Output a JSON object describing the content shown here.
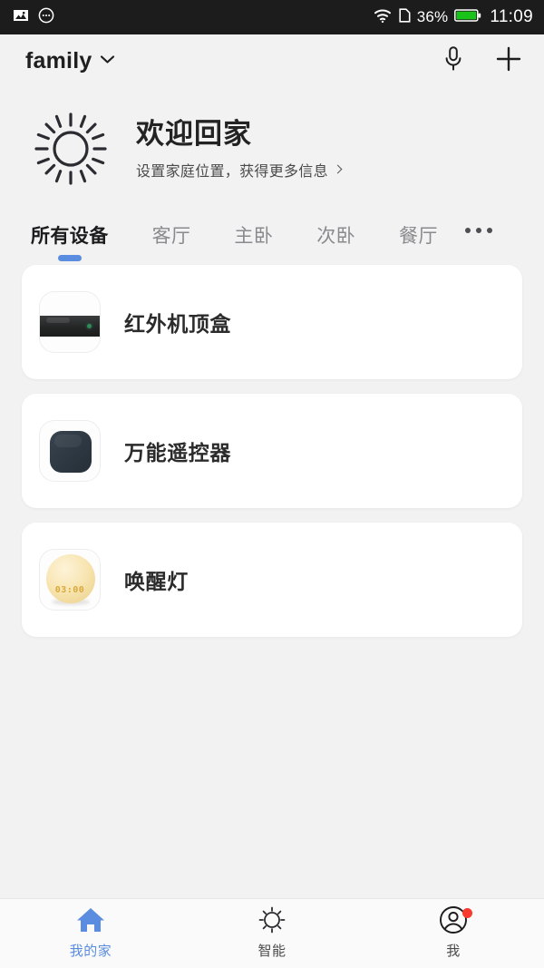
{
  "status_bar": {
    "icons": [
      "image-icon",
      "more-circle-icon",
      "wifi-icon",
      "sim-card-icon",
      "battery-icon"
    ],
    "battery_percent": "36%",
    "time": "11:09",
    "background_color": "#1c1c1c"
  },
  "top_bar": {
    "home_name": "family",
    "dropdown_icon": "chevron-down-icon",
    "mic_icon": "microphone-icon",
    "add_icon": "plus-icon"
  },
  "welcome": {
    "weather_icon": "sun-icon",
    "title": "欢迎回家",
    "subtitle": "设置家庭位置，获得更多信息",
    "chevron": "chevron-right-icon"
  },
  "tabs": {
    "items": [
      {
        "label": "所有设备",
        "active": true
      },
      {
        "label": "客厅",
        "active": false
      },
      {
        "label": "主卧",
        "active": false
      },
      {
        "label": "次卧",
        "active": false
      },
      {
        "label": "餐厅",
        "active": false
      }
    ],
    "overflow_icon": "more-horizontal-icon",
    "active_indicator_color": "#5a8de0"
  },
  "devices": [
    {
      "name": "红外机顶盒",
      "icon": "set-top-box-icon"
    },
    {
      "name": "万能遥控器",
      "icon": "universal-remote-icon"
    },
    {
      "name": "唤醒灯",
      "icon": "wake-up-light-icon",
      "display_time": "03:00"
    }
  ],
  "bottom_nav": {
    "items": [
      {
        "label": "我的家",
        "icon": "home-icon",
        "active": true,
        "badge": false
      },
      {
        "label": "智能",
        "icon": "sun-outline-icon",
        "active": false,
        "badge": false
      },
      {
        "label": "我",
        "icon": "person-circle-icon",
        "active": false,
        "badge": true
      }
    ],
    "active_color": "#5a8de0",
    "badge_color": "#f93a2f"
  }
}
